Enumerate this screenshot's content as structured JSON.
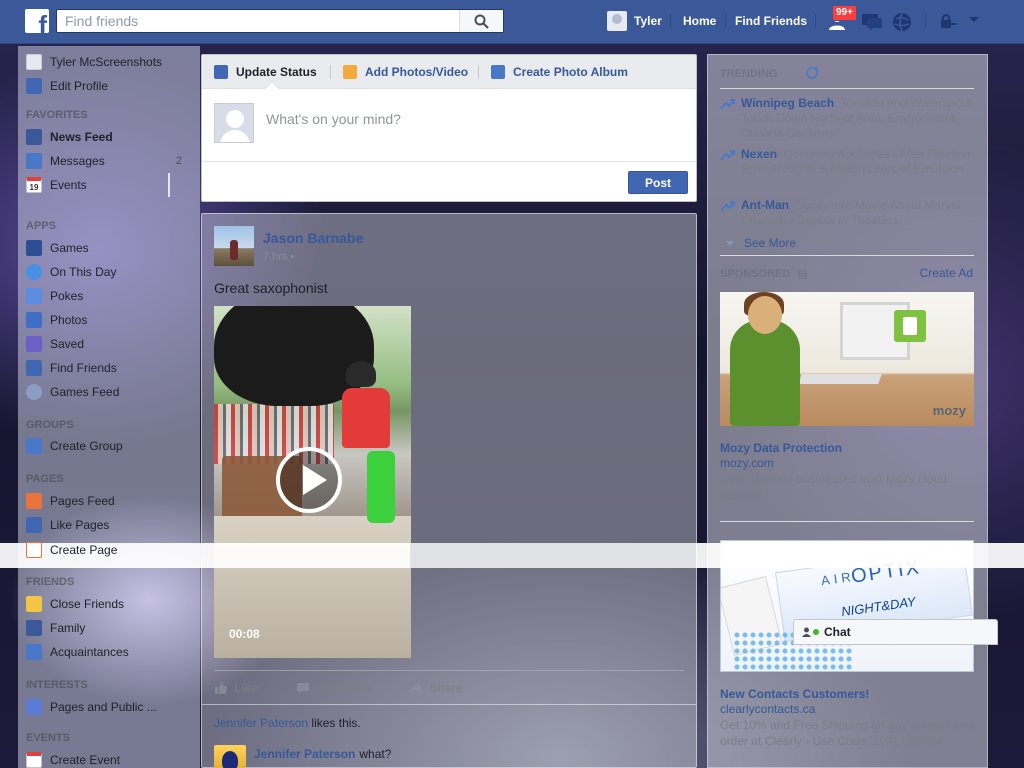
{
  "header": {
    "search_placeholder": "Find friends",
    "user_name": "Tyler",
    "home_label": "Home",
    "find_friends_label": "Find Friends",
    "notifications_badge": "99+"
  },
  "sidebar": {
    "profile_name": "Tyler McScreenshots",
    "edit_profile": "Edit Profile",
    "favorites_heading": "FAVORITES",
    "favorites": [
      {
        "label": "News Feed",
        "icon": "news-feed-icon"
      },
      {
        "label": "Messages",
        "icon": "messages-icon",
        "count": "2"
      },
      {
        "label": "Events",
        "icon": "events-icon",
        "icon_text": "19"
      }
    ],
    "apps_heading": "APPS",
    "apps": [
      {
        "label": "Games",
        "icon": "games-icon"
      },
      {
        "label": "On This Day",
        "icon": "on-this-day-icon"
      },
      {
        "label": "Pokes",
        "icon": "pokes-icon"
      },
      {
        "label": "Photos",
        "icon": "photos-icon"
      },
      {
        "label": "Saved",
        "icon": "saved-icon"
      },
      {
        "label": "Find Friends",
        "icon": "find-friends-icon"
      },
      {
        "label": "Games Feed",
        "icon": "games-feed-icon"
      }
    ],
    "groups_heading": "GROUPS",
    "groups": [
      {
        "label": "Create Group",
        "icon": "create-group-icon"
      }
    ],
    "pages_heading": "PAGES",
    "pages": [
      {
        "label": "Pages Feed",
        "icon": "pages-feed-icon"
      },
      {
        "label": "Like Pages",
        "icon": "like-pages-icon"
      },
      {
        "label": "Create Page",
        "icon": "create-page-icon"
      }
    ],
    "friends_heading": "FRIENDS",
    "friends": [
      {
        "label": "Close Friends",
        "icon": "close-friends-icon"
      },
      {
        "label": "Family",
        "icon": "family-icon"
      },
      {
        "label": "Acquaintances",
        "icon": "acquaintances-icon"
      }
    ],
    "interests_heading": "INTERESTS",
    "interests": [
      {
        "label": "Pages and Public ...",
        "icon": "pages-public-icon"
      }
    ],
    "events_heading": "EVENTS",
    "events": [
      {
        "label": "Create Event",
        "icon": "create-event-icon"
      }
    ]
  },
  "composer": {
    "tab_status": "Update Status",
    "tab_photos": "Add Photos/Video",
    "tab_album": "Create Photo Album",
    "placeholder": "What's on your mind?",
    "post_label": "Post"
  },
  "story": {
    "author": "Jason Barnabe",
    "time": "7 hrs",
    "text": "Great saxophonist",
    "video_duration": "00:08",
    "like_label": "Like",
    "comment_label": "Comment",
    "share_label": "Share",
    "liker_name": "Jennifer Paterson",
    "likes_suffix": " likes this.",
    "comment_author": "Jennifer Paterson",
    "comment_text": "what?"
  },
  "trending": {
    "heading": "TRENDING",
    "items": [
      {
        "name": "Winnipeg Beach",
        "desc": ": Tornado and Waterspout Touch Down North of Area, Environment Canada Confirms"
      },
      {
        "name": "Nexen",
        "desc": ": Company Apologizes After Pipeline Spills Roughly 5 Million Liters of Emulsion"
      },
      {
        "name": "Ant-Man",
        "desc": ": Superhero Movie About Marvel Character Debuts in Theaters"
      }
    ],
    "see_more": "See More"
  },
  "sponsored": {
    "heading": "SPONSORED",
    "create_ad": "Create Ad",
    "ads": [
      {
        "title": "Mozy Data Protection",
        "link": "mozy.com",
        "desc": "Over 100,000 businesses trust Mozy cloud backup!",
        "image_brand": "mozy"
      },
      {
        "title": "New Contacts Customers!",
        "link": "clearlycontacts.ca",
        "desc": "Get 10% and Free Shipping on any contact lens order at Clearly - Use Code: 10PLUSFSM",
        "image_text_1": "AIR",
        "image_text_2": "OPTIX",
        "image_text_3": "NIGHT&DAY"
      }
    ]
  },
  "chat": {
    "label": "Chat"
  },
  "colors": {
    "brand": "#3b5998",
    "link": "#365899",
    "button": "#4267b2",
    "badge": "#fa3e3e"
  }
}
